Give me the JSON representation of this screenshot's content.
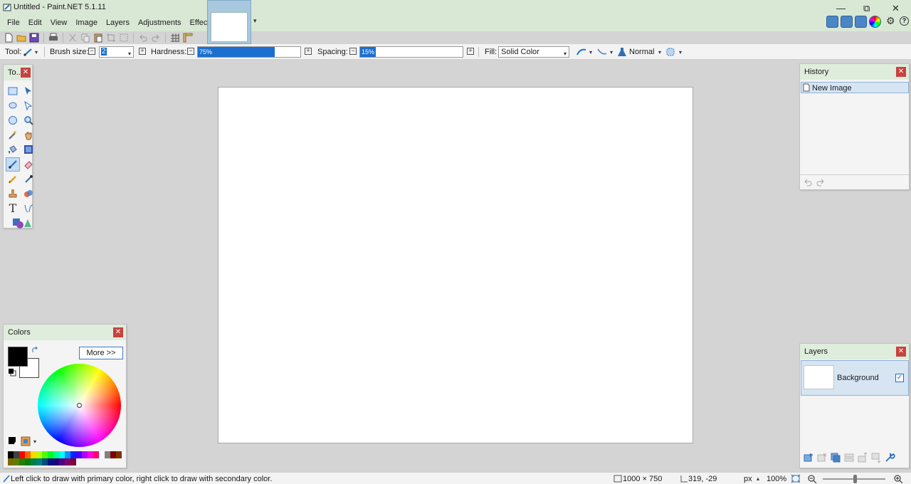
{
  "window": {
    "title": "Untitled - Paint.NET 5.1.11",
    "minimize_glyph": "—",
    "restore_glyph": "⧉",
    "close_glyph": "✕"
  },
  "menu": [
    "File",
    "Edit",
    "View",
    "Image",
    "Layers",
    "Adjustments",
    "Effects"
  ],
  "toolbar": {
    "tool_label": "Tool:",
    "brush_size_label": "Brush size:",
    "brush_size_value": "2",
    "hardness_label": "Hardness:",
    "hardness_value": "75%",
    "hardness_fraction": 0.75,
    "spacing_label": "Spacing:",
    "spacing_value": "15%",
    "spacing_fraction": 0.15,
    "fill_label": "Fill:",
    "fill_value": "Solid Color",
    "blend_mode": "Normal"
  },
  "panels": {
    "tools": {
      "title": "To...",
      "selected": "paintbrush"
    },
    "history": {
      "title": "History",
      "items": [
        "New Image"
      ]
    },
    "colors": {
      "title": "Colors",
      "more_button": "More >>",
      "primary_color": "#000000",
      "secondary_color": "#ffffff"
    },
    "layers": {
      "title": "Layers",
      "items": [
        {
          "name": "Background",
          "visible": true
        }
      ]
    }
  },
  "palette": [
    "#000000",
    "#404040",
    "#ff0000",
    "#ff6a00",
    "#ffd800",
    "#b6ff00",
    "#4cff00",
    "#00ff21",
    "#00ff90",
    "#00ffff",
    "#0094ff",
    "#0026ff",
    "#4800ff",
    "#b200ff",
    "#ff00dc",
    "#ff006e",
    "#ffffff",
    "#808080",
    "#7f0000",
    "#7f3300",
    "#7f6a00",
    "#5b7f00",
    "#267f00",
    "#007f0e",
    "#007f46",
    "#007f7f",
    "#004a7f",
    "#00137f",
    "#21007f",
    "#57007f",
    "#7f006e",
    "#7f0037"
  ],
  "status": {
    "hint": "Left click to draw with primary color, right click to draw with secondary color.",
    "image_size": "1000 × 750",
    "cursor_pos": "319, -29",
    "units": "px",
    "zoom": "100%"
  },
  "colors_theme": {
    "title_bg": "#d9e8d5",
    "accent": "#1b6fd0"
  }
}
